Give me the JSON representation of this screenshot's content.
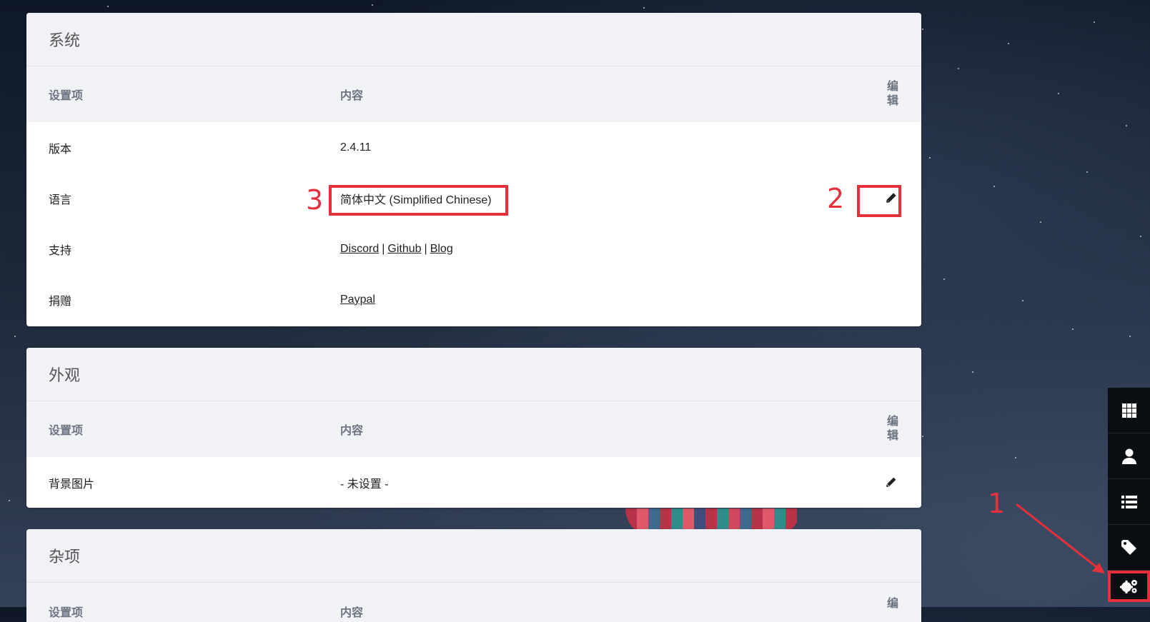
{
  "sections": [
    {
      "title": "系统",
      "headers": {
        "key": "设置项",
        "value": "内容",
        "edit": "编辑"
      },
      "rows": [
        {
          "key": "版本",
          "value": "2.4.11"
        },
        {
          "key": "语言",
          "value": "简体中文 (Simplified Chinese)"
        },
        {
          "key": "支持",
          "links": [
            "Discord",
            "Github",
            "Blog"
          ],
          "separator": "|"
        },
        {
          "key": "捐赠",
          "links": [
            "Paypal"
          ]
        }
      ]
    },
    {
      "title": "外观",
      "headers": {
        "key": "设置项",
        "value": "内容",
        "edit": "编辑"
      },
      "rows": [
        {
          "key": "背景图片",
          "value": "- 未设置 -"
        }
      ]
    },
    {
      "title": "杂项",
      "headers": {
        "key": "设置项",
        "value": "内容",
        "edit": "编"
      }
    }
  ],
  "annotations": {
    "one": "1",
    "two": "2",
    "three": "3"
  },
  "sidebar": [
    "grid-icon",
    "user-icon",
    "list-icon",
    "tag-icon",
    "gears-icon"
  ],
  "colors": {
    "annotation": "#e8303a",
    "sidebar_bg": "#0a0d12",
    "header_bg": "#f1f2f6"
  }
}
